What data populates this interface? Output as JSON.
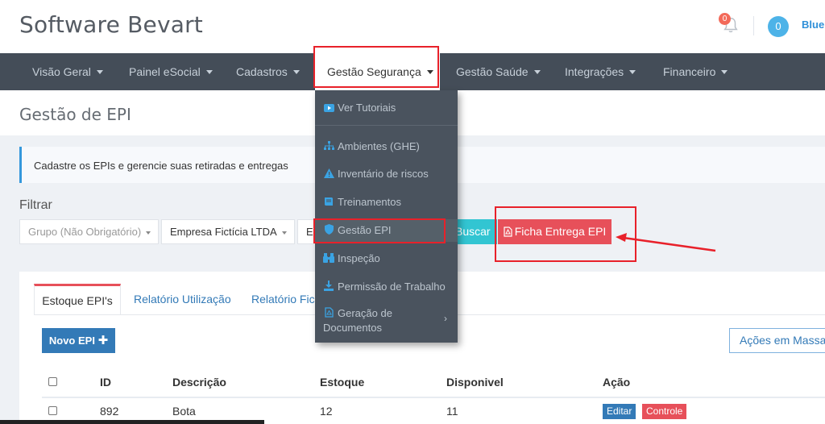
{
  "header": {
    "brand": "Software Bevart",
    "notifications_count": "0",
    "user_count": "0",
    "user_name": "Blue"
  },
  "nav": {
    "items": [
      {
        "label": "Visão Geral"
      },
      {
        "label": "Painel eSocial"
      },
      {
        "label": "Cadastros"
      },
      {
        "label": "Gestão Segurança",
        "active": true
      },
      {
        "label": "Gestão Saúde"
      },
      {
        "label": "Integrações"
      },
      {
        "label": "Financeiro"
      }
    ]
  },
  "dropdown": {
    "items": [
      {
        "label": "Ver Tutoriais",
        "icon": "youtube-icon"
      },
      {
        "label": "Ambientes (GHE)",
        "icon": "sitemap-icon"
      },
      {
        "label": "Inventário de riscos",
        "icon": "warning-icon"
      },
      {
        "label": "Treinamentos",
        "icon": "book-icon"
      },
      {
        "label": "Gestão EPI",
        "icon": "shield-icon"
      },
      {
        "label": "Inspeção",
        "icon": "binoculars-icon"
      },
      {
        "label": "Permissão de Trabalho",
        "icon": "download-icon"
      },
      {
        "label": "Geração de",
        "label2": "Documentos",
        "icon": "file-pdf-icon",
        "has_submenu": true
      }
    ]
  },
  "page": {
    "title": "Gestão de EPI",
    "alert": "Cadastre os EPIs e gerencie suas retiradas e entregas",
    "filter_label": "Filtrar",
    "filters": {
      "grupo_placeholder": "Grupo (Não Obrigatório)",
      "empresa_value": "Empresa Fictícia LTDA",
      "third_value": "E"
    },
    "buscar_label": "Buscar",
    "ficha_label": "Ficha Entrega EPI"
  },
  "tabs": [
    {
      "label": "Estoque EPI's",
      "active": true
    },
    {
      "label": "Relatório Utilização"
    },
    {
      "label": "Relatório Fich"
    }
  ],
  "actions": {
    "novo_label": "Novo EPI",
    "massa_label": "Ações em Massa"
  },
  "table": {
    "headers": [
      "ID",
      "Descrição",
      "Estoque",
      "Disponivel",
      "Ação"
    ],
    "rows": [
      {
        "id": "892",
        "descricao": "Bota",
        "estoque": "12",
        "disponivel": "11",
        "editar": "Editar",
        "controle": "Controle"
      }
    ]
  },
  "colors": {
    "nav_bg": "#444d58",
    "accent_red": "#e7505a",
    "buscar_teal": "#32c5d2",
    "primary_blue": "#337ab7",
    "highlight": "#e8212a"
  }
}
